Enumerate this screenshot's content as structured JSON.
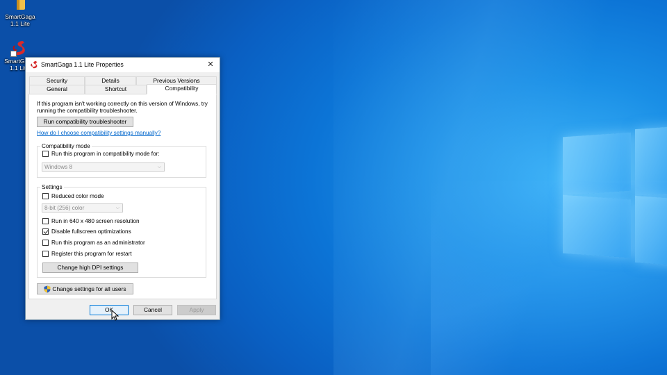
{
  "desktop": {
    "icons": [
      {
        "label": "SmartGaga\n1.1 Lite",
        "icon": "app-icon"
      },
      {
        "label": "SmartGaga\n1.1 Lite",
        "icon": "app-shortcut-icon"
      }
    ]
  },
  "dialog": {
    "title": "SmartGaga 1.1 Lite Properties",
    "close_icon": "close-icon",
    "tabs_row1": [
      "Security",
      "Details",
      "Previous Versions"
    ],
    "tabs_row2": [
      "General",
      "Shortcut",
      "Compatibility"
    ],
    "active_tab": "Compatibility",
    "intro_text": "If this program isn't working correctly on this version of Windows, try running the compatibility troubleshooter.",
    "troubleshooter_button": "Run compatibility troubleshooter",
    "help_link": "How do I choose compatibility settings manually?",
    "compat_mode": {
      "label": "Compatibility mode",
      "checkbox": "Run this program in compatibility mode for:",
      "checked": false,
      "select_value": "Windows 8"
    },
    "settings": {
      "label": "Settings",
      "reduced_color": {
        "label": "Reduced color mode",
        "checked": false
      },
      "color_select_value": "8-bit (256) color",
      "resolution": {
        "label": "Run in 640 x 480 screen resolution",
        "checked": false
      },
      "fullscreen": {
        "label": "Disable fullscreen optimizations",
        "checked": true
      },
      "admin": {
        "label": "Run this program as an administrator",
        "checked": false
      },
      "restart": {
        "label": "Register this program for restart",
        "checked": false
      },
      "dpi_button": "Change high DPI settings"
    },
    "all_users_button": "Change settings for all users",
    "ok_button": "OK",
    "cancel_button": "Cancel",
    "apply_button": "Apply"
  },
  "colors": {
    "desktop_blue": "#0c74d6",
    "link": "#0066cc",
    "dialog_bg": "#f0f0f0"
  }
}
